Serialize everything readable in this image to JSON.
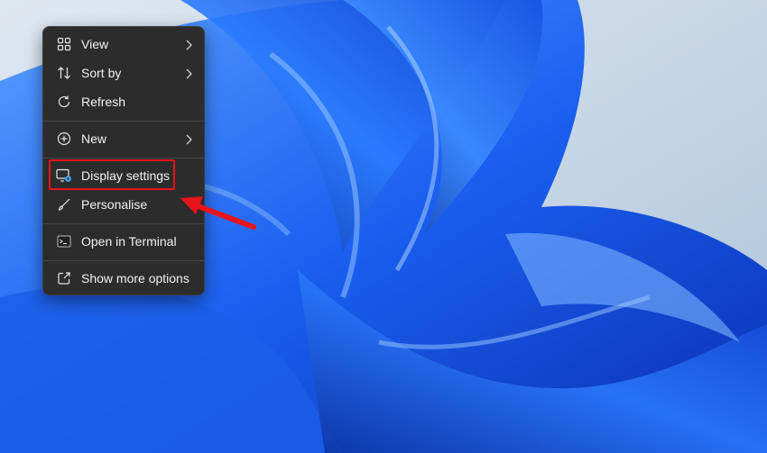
{
  "menu": {
    "items": [
      {
        "label": "View",
        "icon": "view-grid-icon",
        "submenu": true
      },
      {
        "label": "Sort by",
        "icon": "sort-icon",
        "submenu": true
      },
      {
        "label": "Refresh",
        "icon": "refresh-icon",
        "submenu": false
      },
      {
        "label": "New",
        "icon": "plus-circle-icon",
        "submenu": true
      },
      {
        "label": "Display settings",
        "icon": "display-settings-icon",
        "submenu": false,
        "highlighted": true
      },
      {
        "label": "Personalise",
        "icon": "brush-icon",
        "submenu": false
      },
      {
        "label": "Open in Terminal",
        "icon": "terminal-icon",
        "submenu": false
      },
      {
        "label": "Show more options",
        "icon": "open-external-icon",
        "submenu": false
      }
    ]
  },
  "colors": {
    "menu_bg": "#2c2c2c",
    "menu_text": "#f2f2f2",
    "highlight_border": "#e8141b",
    "arrow": "#e8141b",
    "wallpaper_blue": "#1b5ee8"
  }
}
